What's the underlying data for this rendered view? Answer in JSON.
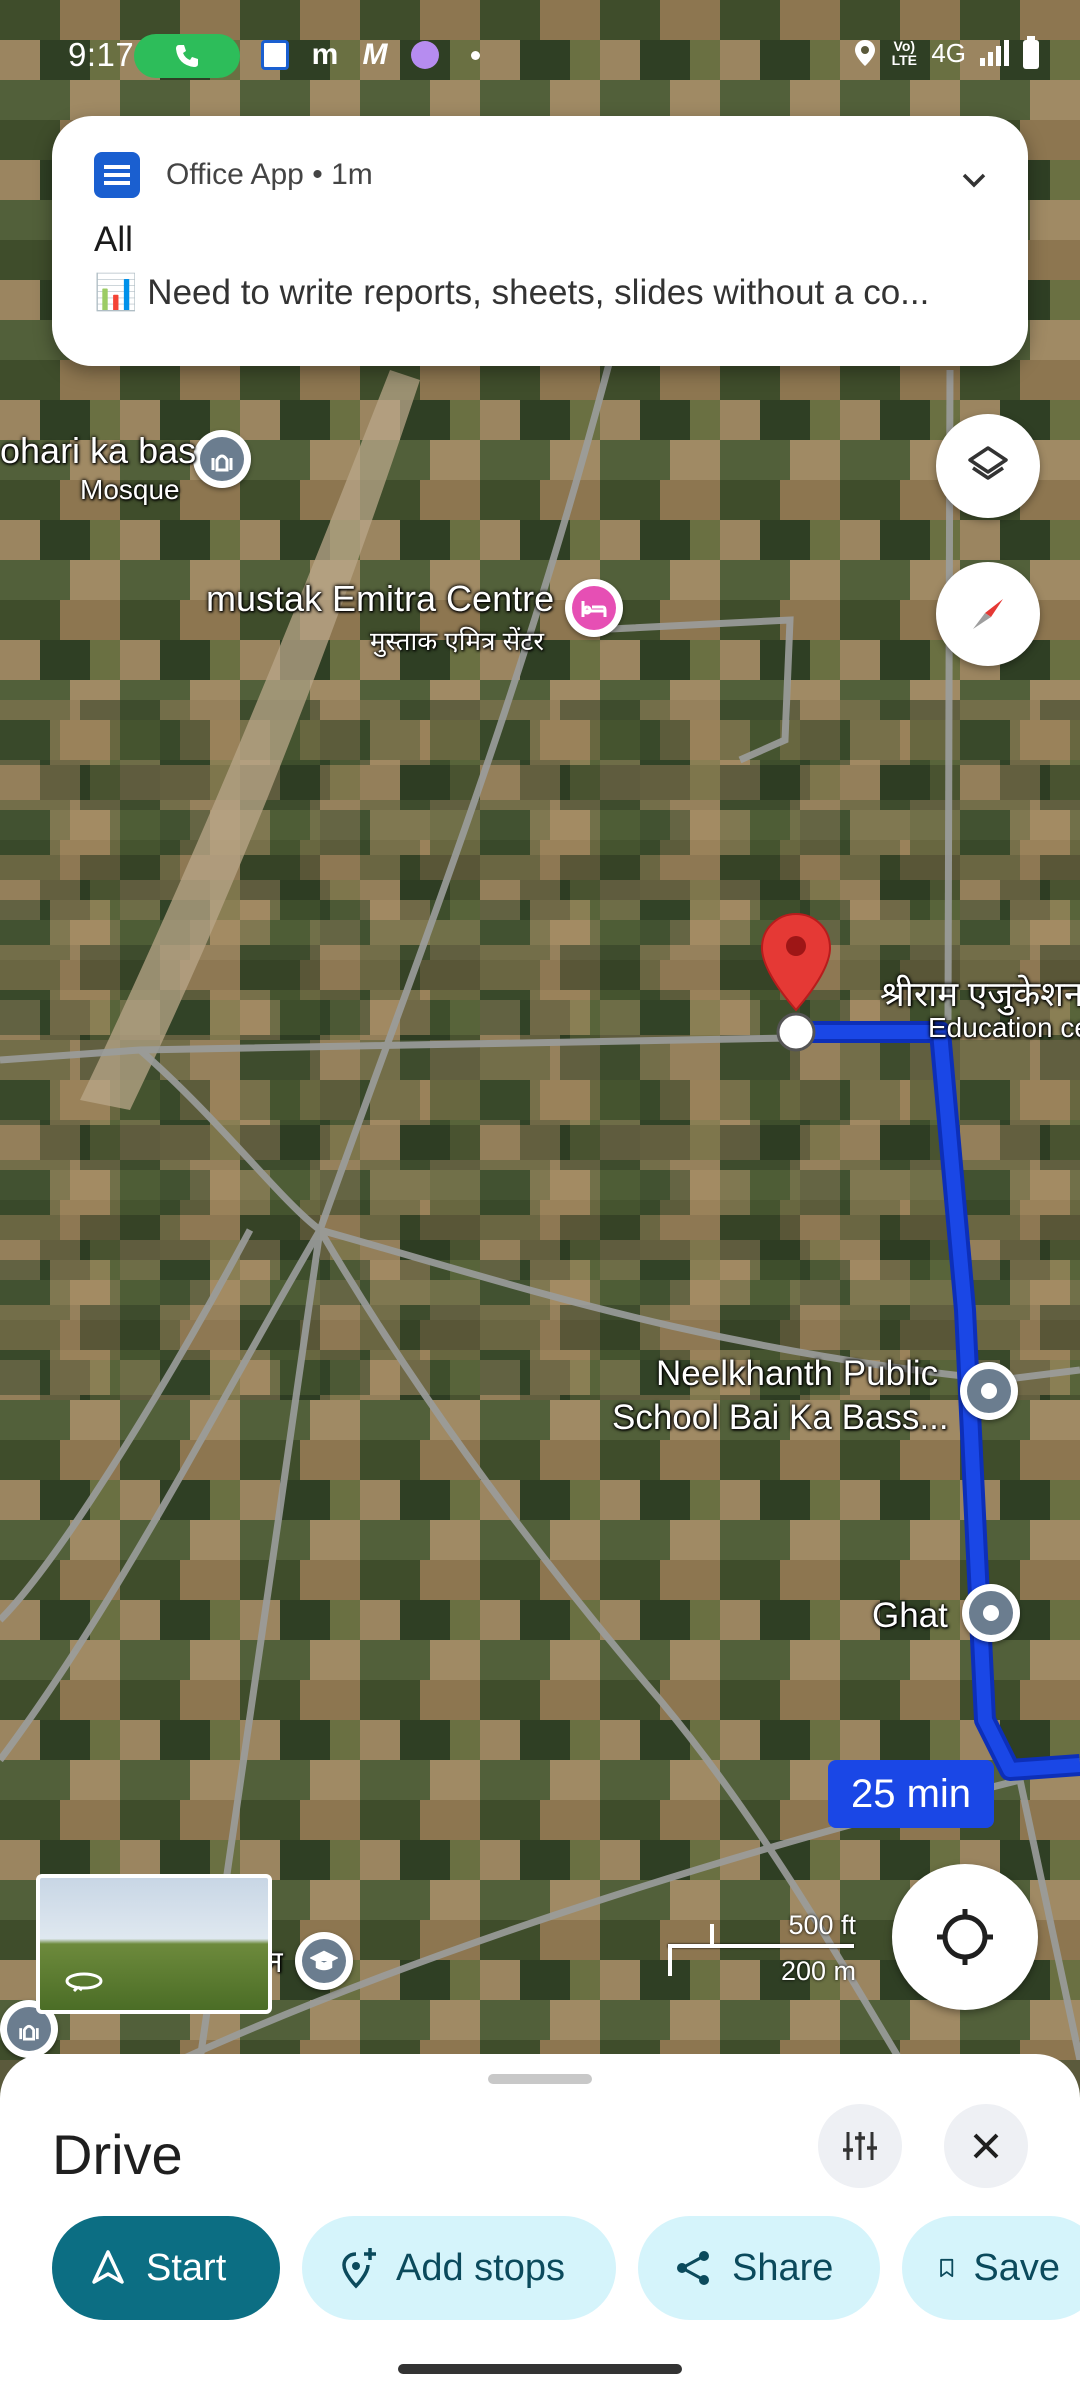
{
  "status_bar": {
    "time": "9:17",
    "network": "4G",
    "volte": "Vo) LTE",
    "icons": [
      "call-active-icon",
      "office-app-icon",
      "m-icon",
      "m-logo-icon",
      "alarm-icon",
      "dot-icon",
      "location-icon",
      "signal-icon",
      "battery-icon"
    ]
  },
  "notification": {
    "app_name": "Office App",
    "time_ago": "1m",
    "title": "All",
    "body": "📊 Need to write reports, sheets, slides without a co..."
  },
  "map": {
    "labels": {
      "mosque_name": "ohari ka bas",
      "mosque_type": "Mosque",
      "emitra_name": "mustak Emitra Centre",
      "emitra_hindi": "मुस्ताक एमित्र सेंटर",
      "shriram_hindi": "श्रीराम एजुकेशन",
      "shriram_type": "Education ce",
      "school_line1": "Neelkhanth Public",
      "school_line2": "School Bai Ka Bass...",
      "ghat": "Ghat",
      "edu_partial": "न"
    },
    "eta": "25 min",
    "scale": {
      "imperial": "500 ft",
      "metric": "200 m"
    },
    "route_color": "#1a47e6",
    "destination_pin_color": "#e53935"
  },
  "sheet": {
    "title": "Drive",
    "actions": {
      "start": "Start",
      "add_stops": "Add stops",
      "share": "Share",
      "save": "Save"
    }
  }
}
